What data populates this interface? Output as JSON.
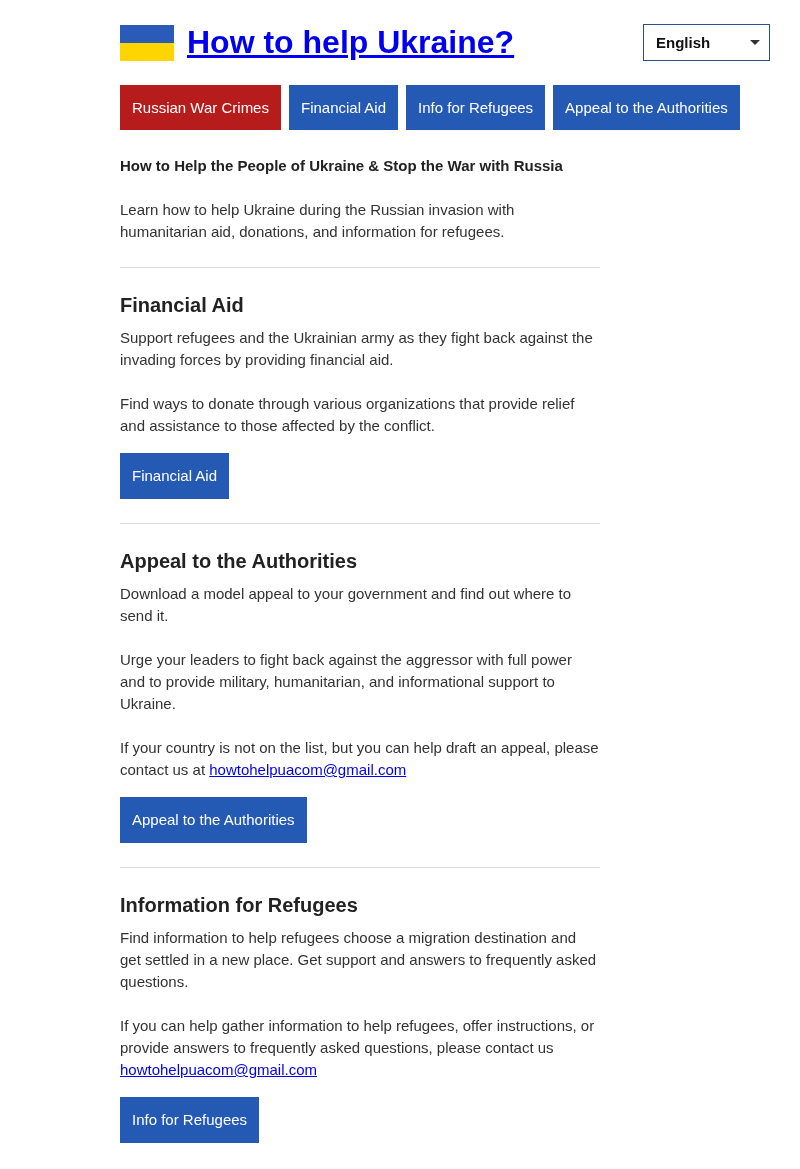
{
  "header": {
    "title": "How to help Ukraine?",
    "language": "English"
  },
  "nav": [
    {
      "label": "Russian War Crimes",
      "color": "#b71c1c"
    },
    {
      "label": "Financial Aid",
      "color": "#255ab4"
    },
    {
      "label": "Info for Refugees",
      "color": "#255ab4"
    },
    {
      "label": "Appeal to the Authorities",
      "color": "#255ab4"
    }
  ],
  "intro": {
    "heading": "How to Help the People of Ukraine & Stop the War with Russia",
    "text": "Learn how to help Ukraine during the Russian invasion with humanitarian aid, donations, and information for refugees."
  },
  "sections": [
    {
      "title": "Financial Aid",
      "paragraphs": [
        {
          "text": "Support refugees and the Ukrainian army as they fight back against the invading forces by providing financial aid."
        },
        {
          "text": "Find ways to donate through various organizations that provide relief and assistance to those affected by the conflict."
        }
      ],
      "button": "Financial Aid"
    },
    {
      "title": "Appeal to the Authorities",
      "paragraphs": [
        {
          "text": "Download a model appeal to your government and find out where to send it."
        },
        {
          "text": "Urge your leaders to fight back against the aggressor with full power and to provide military, humanitarian, and informational support to Ukraine."
        },
        {
          "text": "If your country is not on the list, but you can help draft an appeal, please contact us at",
          "link": "howtohelpuacom@gmail.com"
        }
      ],
      "button": "Appeal to the Authorities"
    },
    {
      "title": "Information for Refugees",
      "paragraphs": [
        {
          "text": "Find information to help refugees choose a migration destination and get settled in a new place. Get support and answers to frequently asked questions."
        },
        {
          "text": "If you can help gather information to help refugees, offer instructions, or provide answers to frequently asked questions, please contact us",
          "link": "howtohelpuacom@gmail.com"
        }
      ],
      "button": "Info for Refugees"
    }
  ]
}
